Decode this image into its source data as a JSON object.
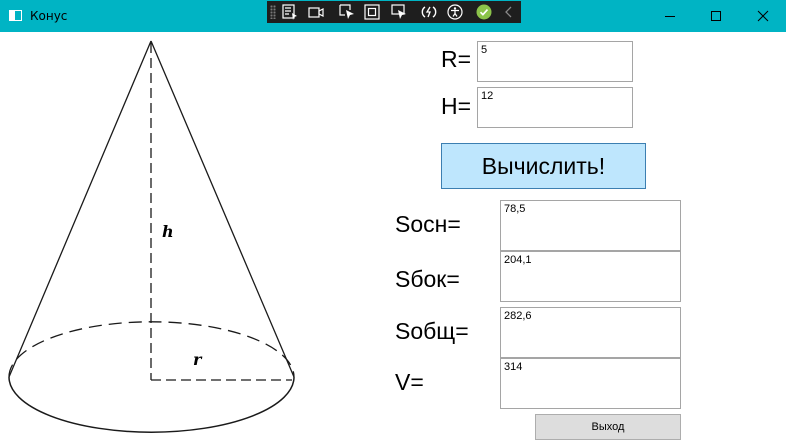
{
  "window": {
    "title": "Конус",
    "titlebar_color": "#00b4c4",
    "controls": [
      "minimize-icon",
      "maximize-icon",
      "close-icon"
    ]
  },
  "debug_toolbar": {
    "icons": [
      "live-visual-tree-icon",
      "record-icon",
      "select-element-icon",
      "display-layout-adorners-icon",
      "track-focus-icon",
      "hot-reload-icon",
      "accessibility-icon",
      "check-icon",
      "collapse-icon"
    ]
  },
  "diagram": {
    "height_label": "h",
    "radius_label": "r"
  },
  "inputs": {
    "r_label": "R=",
    "r_value": "5",
    "h_label": "H=",
    "h_value": "12"
  },
  "calculate_button": {
    "label": "Вычислить!",
    "color": "#bee6fd"
  },
  "results": [
    {
      "label": "Sосн=",
      "value": "78,5"
    },
    {
      "label": "Sбок=",
      "value": "204,1"
    },
    {
      "label": "Sобщ=",
      "value": "282,6"
    },
    {
      "label": "V=",
      "value": "314"
    }
  ],
  "exit_button": {
    "label": "Выход"
  }
}
